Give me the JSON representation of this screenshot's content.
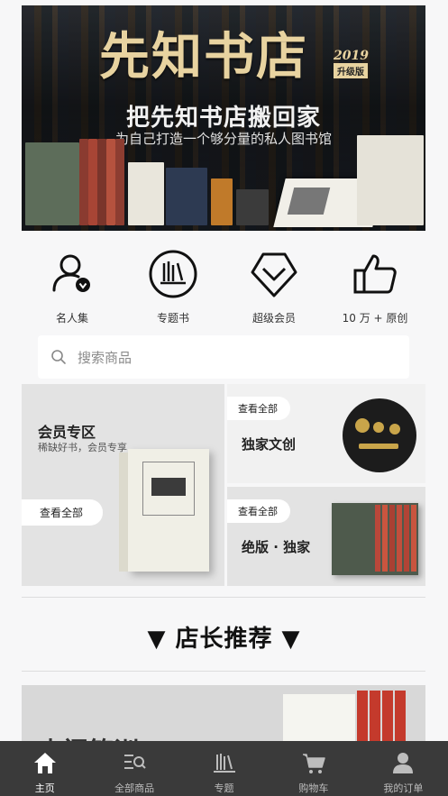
{
  "banner": {
    "title": "先知书店",
    "year": "2019",
    "version": "升级版",
    "subtitle": "把先知书店搬回家",
    "tagline": "为自己打造一个够分量的私人图书馆"
  },
  "shortcuts": [
    {
      "label": "名人集",
      "icon": "person-check-icon"
    },
    {
      "label": "专题书",
      "icon": "books-circle-icon"
    },
    {
      "label": "超级会员",
      "icon": "diamond-icon"
    },
    {
      "label": "10 万 + 原创",
      "icon": "thumbs-up-icon"
    }
  ],
  "search": {
    "placeholder": "搜索商品",
    "icon": "search-icon"
  },
  "features": {
    "member": {
      "title": "会员专区",
      "subtitle": "稀缺好书，会员专享",
      "view_all": "查看全部"
    },
    "creative": {
      "title": "独家文创",
      "view_all": "查看全部"
    },
    "outofprint": {
      "title": "绝版 · 独家",
      "view_all": "查看全部"
    }
  },
  "section": {
    "title": "▼ 店长推荐 ▼"
  },
  "recommend": {
    "partial_text": "内阁答训"
  },
  "tabbar": [
    {
      "label": "主页",
      "icon": "home-icon",
      "active": true
    },
    {
      "label": "全部商品",
      "icon": "list-search-icon",
      "active": false
    },
    {
      "label": "专题",
      "icon": "books-icon",
      "active": false
    },
    {
      "label": "购物车",
      "icon": "cart-icon",
      "active": false
    },
    {
      "label": "我的订单",
      "icon": "user-icon",
      "active": false
    }
  ],
  "colors": {
    "tabbar_bg": "#3a3a3a",
    "banner_gold": "#e8d3a0",
    "page_bg": "#f7f7f8"
  }
}
